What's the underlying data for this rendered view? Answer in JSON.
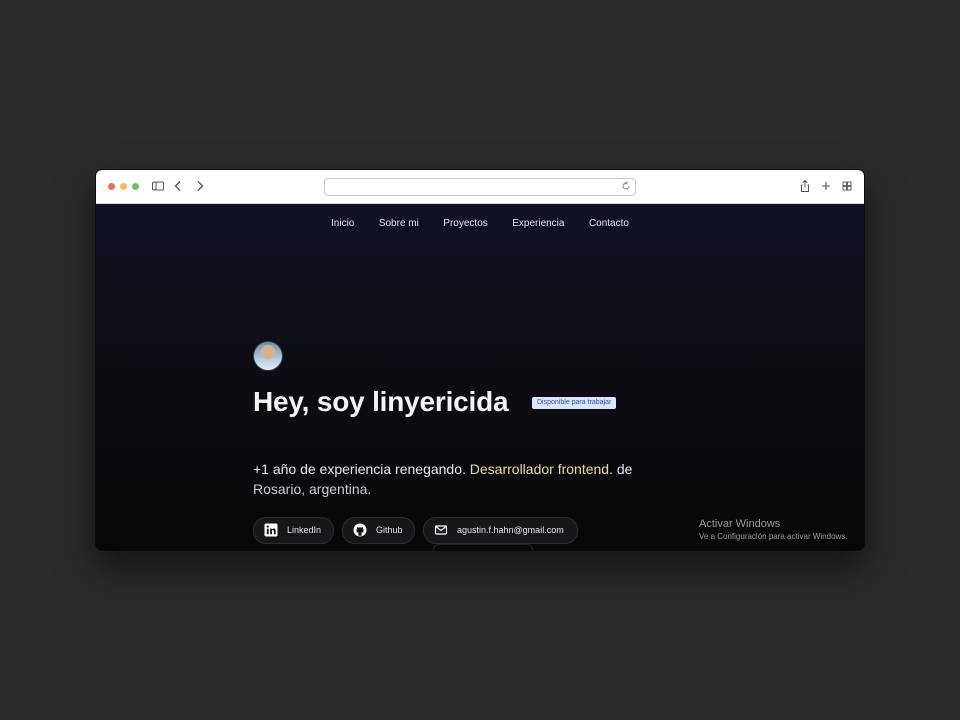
{
  "browser": {
    "url": "",
    "icons": [
      "sidebar-icon",
      "back-icon",
      "forward-icon",
      "reload-icon",
      "share-icon",
      "new-tab-icon",
      "tab-overview-icon"
    ]
  },
  "nav": {
    "items": [
      {
        "label": "Inicio"
      },
      {
        "label": "Sobre mi"
      },
      {
        "label": "Proyectos"
      },
      {
        "label": "Experiencia"
      },
      {
        "label": "Contacto"
      }
    ]
  },
  "hero": {
    "title": "Hey, soy linyericida",
    "badge": "Disponible para trabajar",
    "bio_start": "+1 año de experiencia renegando. ",
    "bio_highlight": "Desarrollador frontend.",
    "bio_mid": " de",
    "bio_location": "Rosario, argentina.",
    "buttons": [
      {
        "label": "LinkedIn",
        "icon": "linkedin-icon"
      },
      {
        "label": "Github",
        "icon": "github-icon"
      },
      {
        "label": "agustin.f.hahn@gmail.com",
        "icon": "mail-icon"
      }
    ]
  },
  "windows_notice": {
    "title": "Activar Windows",
    "subtitle": "Ve a Configuración para activar Windows."
  },
  "colors": {
    "background": "#2b2b2c",
    "highlight": "#f1dc8e",
    "badge_bg": "#dbe6ff",
    "badge_text": "#2a4fc2"
  }
}
